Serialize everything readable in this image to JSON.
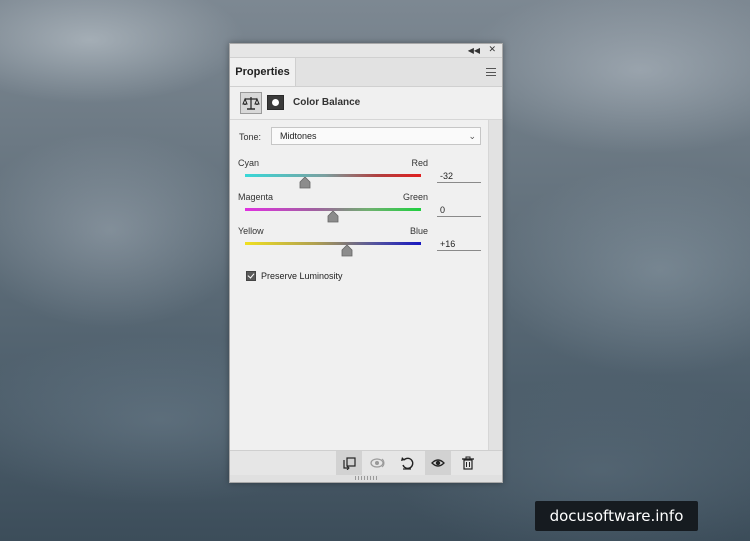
{
  "panel": {
    "tab_label": "Properties",
    "adjustment_title": "Color Balance",
    "tone": {
      "label": "Tone:",
      "selected": "Midtones"
    },
    "sliders": [
      {
        "left_label": "Cyan",
        "right_label": "Red",
        "value": "-32",
        "position_fraction": 0.34
      },
      {
        "left_label": "Magenta",
        "right_label": "Green",
        "value": "0",
        "position_fraction": 0.5
      },
      {
        "left_label": "Yellow",
        "right_label": "Blue",
        "value": "+16",
        "position_fraction": 0.58
      }
    ],
    "preserve_luminosity": {
      "label": "Preserve Luminosity",
      "checked": true
    },
    "footer_icons": [
      "clip-to-layer-icon",
      "view-previous-state-icon",
      "reset-icon",
      "visibility-eye-icon",
      "delete-icon"
    ]
  },
  "watermark": "docusoftware.info",
  "colors": {
    "panel_bg": "#f0f0f0",
    "cyan": "#38d8d8",
    "red": "#e02020",
    "magenta": "#e030e0",
    "green": "#20d040",
    "yellow": "#f0e020",
    "blue": "#1818c0"
  }
}
